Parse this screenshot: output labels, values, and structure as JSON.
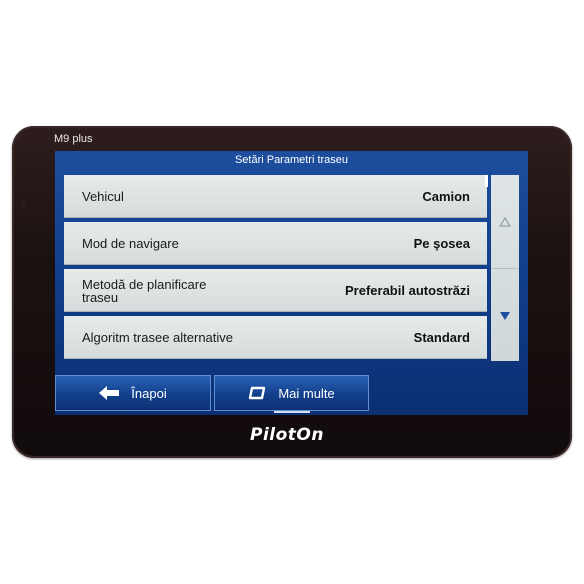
{
  "device": {
    "model": "M9 plus",
    "brand_logo": "PilotOn"
  },
  "screen": {
    "title": "Setări Parametri traseu",
    "items": [
      {
        "label": "Vehicul",
        "value": "Camion"
      },
      {
        "label": "Mod de navigare",
        "value": "Pe şosea"
      },
      {
        "label": "Metodă de planificare traseu",
        "value": "Preferabil autostrăzi"
      },
      {
        "label": "Algoritm trasee alternative",
        "value": "Standard"
      }
    ],
    "scroll": {
      "up_icon": "triangle-up-icon",
      "down_icon": "triangle-down-icon"
    },
    "bottom": {
      "back_label": "Înapoi",
      "back_icon": "arrow-left-icon",
      "more_label": "Mai multe",
      "more_icon": "rounded-square-icon"
    }
  },
  "colors": {
    "accent": "#103d8a",
    "row_bg": "#dde2e1",
    "bezel": "#1b1111"
  }
}
